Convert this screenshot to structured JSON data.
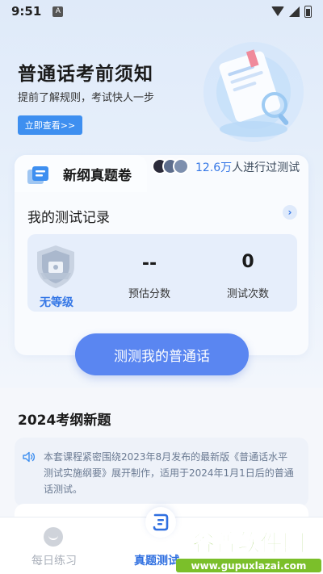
{
  "status_bar": {
    "time": "9:51",
    "indicator": "A"
  },
  "hero": {
    "title": "普通话考前须知",
    "subtitle": "提前了解规则，考试快人一步",
    "button_label": "立即查看>>"
  },
  "exam_card": {
    "tab_label": "新纲真题卷",
    "tested_count": "12.6万",
    "tested_suffix": "人进行过测试",
    "record_title": "我的测试记录",
    "arrow": "›",
    "level_label": "无等级",
    "estimated_score_value": "--",
    "estimated_score_label": "预估分数",
    "test_count_value": "0",
    "test_count_label": "测试次数",
    "cta_label": "测测我的普通话"
  },
  "section": {
    "title": "2024考纲新题",
    "notice": "本套课程紧密围绕2023年8月发布的最新版《普通话水平测试实施纲要》展开制作，适用于2024年1月1日后的普通话测试。"
  },
  "bottom_nav": {
    "items": [
      {
        "label": "每日练习",
        "active": false
      },
      {
        "label": "真题测试",
        "active": true
      }
    ]
  },
  "watermark": {
    "text": "谷普软件园",
    "url_text": "www.gupuxlazai.com"
  },
  "colors": {
    "accent": "#3e8ff0",
    "cta": "#5a86f1",
    "active_nav": "#2f6fe0",
    "badge": "#3577e6"
  },
  "icons": [
    "wifi-icon",
    "signal-icon",
    "battery-icon",
    "document-search-illustration",
    "exam-paper-icon",
    "shield-badge-icon",
    "speaker-icon",
    "chat-bubble-icon",
    "exam-tab-icon"
  ]
}
